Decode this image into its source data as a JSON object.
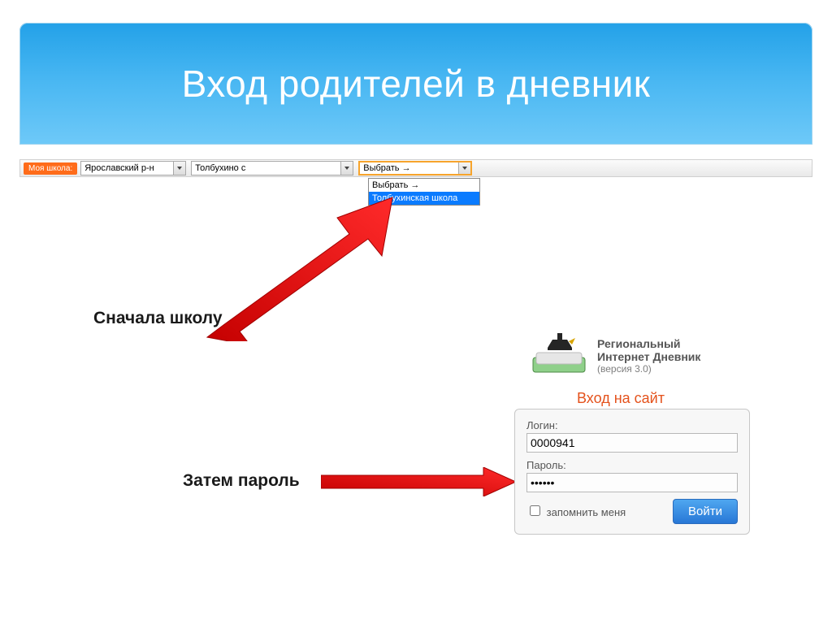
{
  "header": {
    "title": "Вход родителей в дневник"
  },
  "schoolBar": {
    "badge": "Моя школа:",
    "select1": "Ярославский р-н",
    "select2": "Толбухино с",
    "select3": "Выбрать →",
    "options": [
      "Выбрать →",
      "Толбухинская школа"
    ]
  },
  "annot": {
    "first": "Сначала школу",
    "then": "Затем пароль"
  },
  "diary": {
    "line1": "Региональный",
    "line2": "Интернет Дневник",
    "ver": "(версия 3.0)",
    "caption": "Вход на сайт"
  },
  "login": {
    "login_label": "Логин:",
    "login_value": "0000941",
    "pass_label": "Пароль:",
    "pass_value": "••••••",
    "remember": "запомнить меня",
    "submit": "Войти"
  }
}
